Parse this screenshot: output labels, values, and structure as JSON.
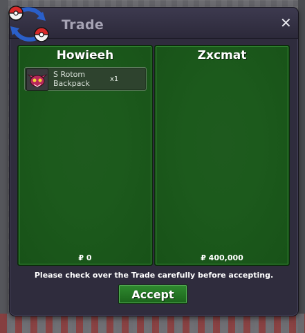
{
  "window": {
    "title": "Trade"
  },
  "offers": [
    {
      "player": "Howieeh",
      "items": [
        {
          "name": "S Rotom Backpack",
          "quantity": "x1",
          "icon": "rotom-backpack-icon"
        }
      ],
      "money": "₽ 0"
    },
    {
      "player": "Zxcmat",
      "items": [],
      "money": "₽ 400,000"
    }
  ],
  "notice": "Please check over the Trade carefully before accepting.",
  "accept_label": "Accept",
  "colors": {
    "panel_green": "#1c5a1c",
    "window_bg": "#2f2c3d",
    "accept_green": "#22732a"
  }
}
